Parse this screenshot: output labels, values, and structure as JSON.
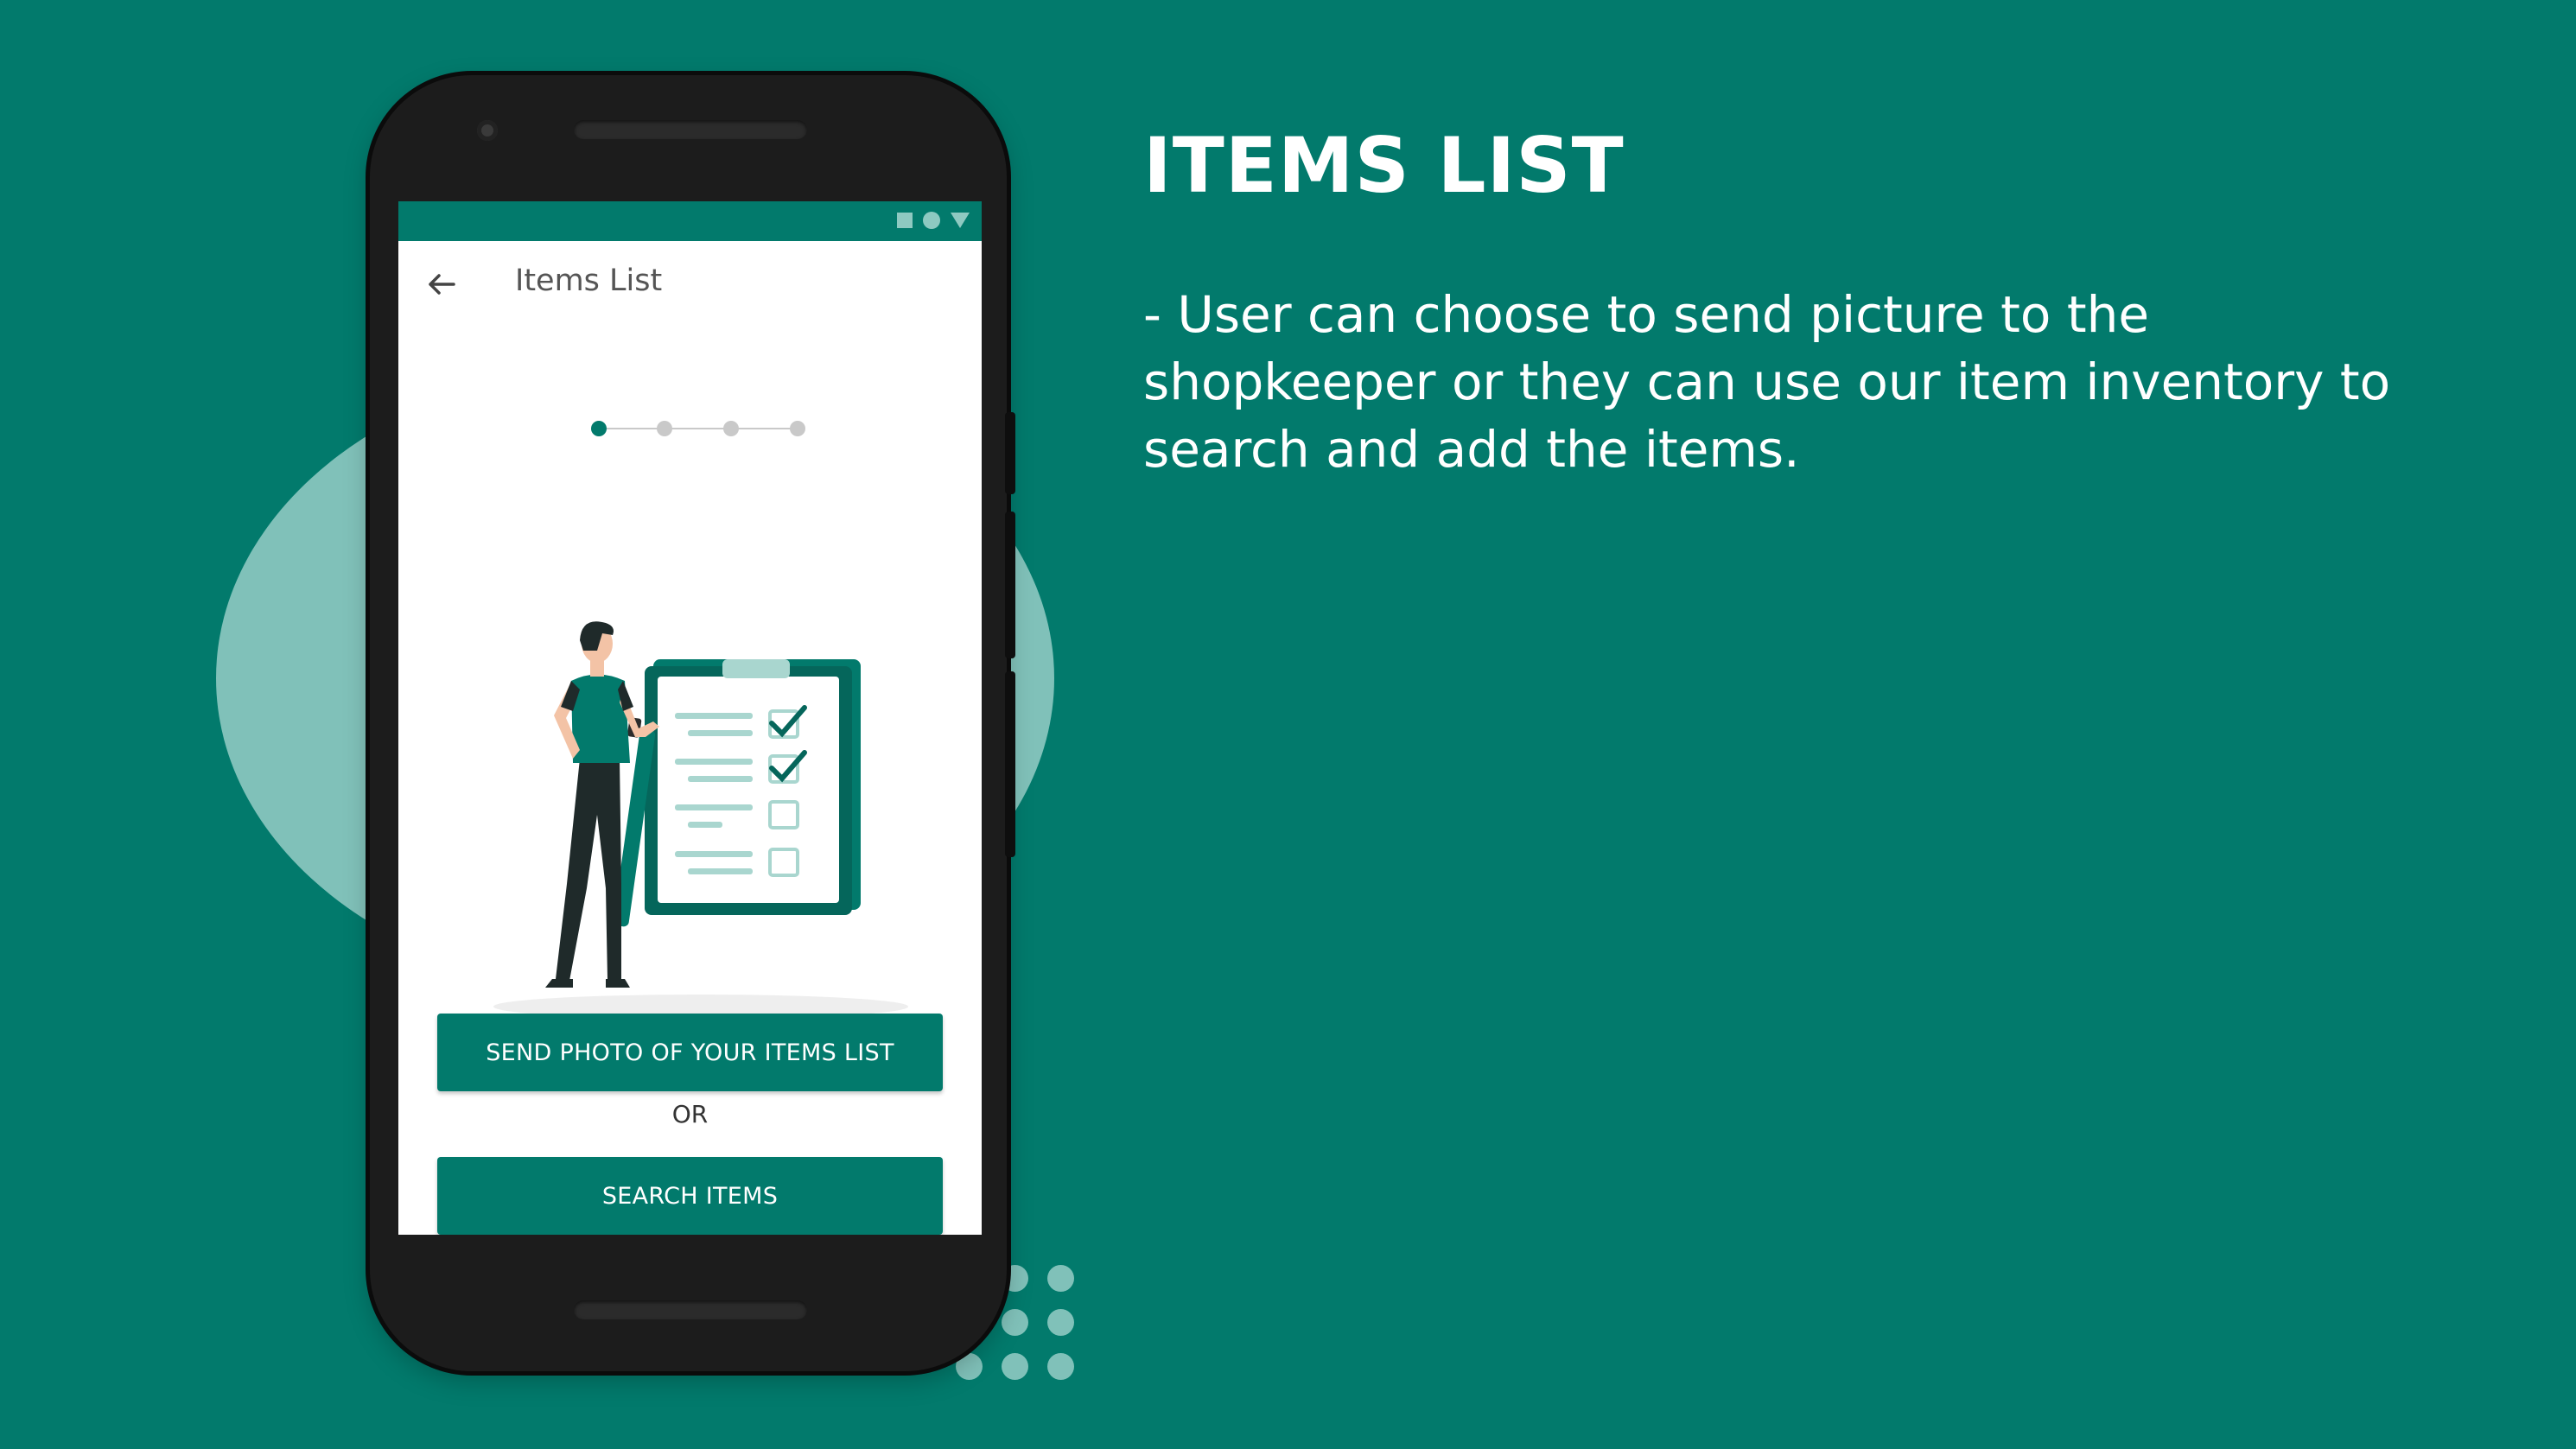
{
  "colors": {
    "background": "#027a6c",
    "accent_light": "#80c1b9",
    "phone_body": "#1c1c1c",
    "screen": "#ffffff",
    "button": "#027a6c",
    "button_text": "#ffffff"
  },
  "slide": {
    "heading": "ITEMS LIST",
    "description": "- User can choose to send picture to the shopkeeper or they can use our item inventory to search and add the items."
  },
  "phone": {
    "status_bar": {
      "icons": [
        "square-icon",
        "circle-icon",
        "triangle-icon"
      ]
    },
    "app_bar": {
      "back_icon": "arrow-left-icon",
      "title": "Items List"
    },
    "stepper": {
      "total_steps": 4,
      "current_step": 1
    },
    "illustration": "person-with-checklist-illustration",
    "send_photo_button": "SEND PHOTO OF YOUR ITEMS LIST",
    "or_label": "OR",
    "search_button": "SEARCH ITEMS"
  }
}
